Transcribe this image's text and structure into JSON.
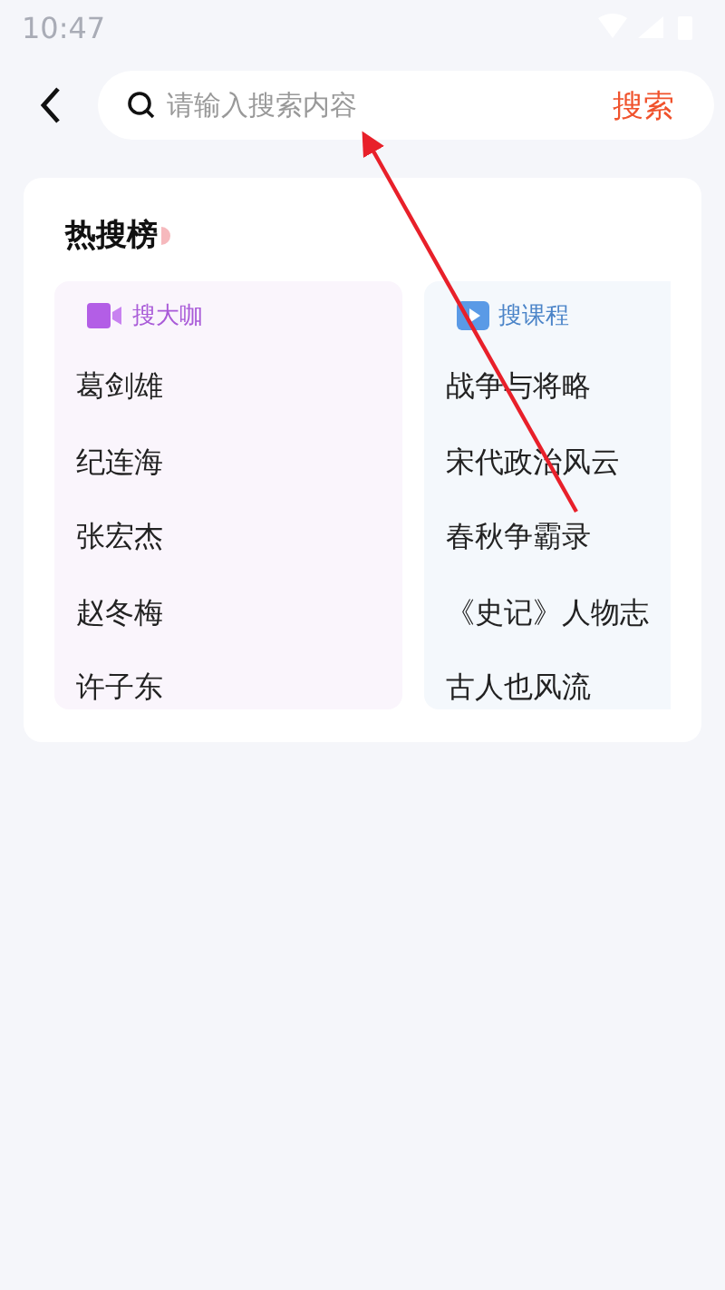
{
  "status_bar": {
    "time": "10:47"
  },
  "search": {
    "placeholder": "请输入搜索内容",
    "button": "搜索"
  },
  "hot": {
    "title": "热搜榜",
    "columns": [
      {
        "kind": "people",
        "title": "搜大咖",
        "items": [
          "葛剑雄",
          "纪连海",
          "张宏杰",
          "赵冬梅",
          "许子东"
        ]
      },
      {
        "kind": "courses",
        "title": "搜课程",
        "items": [
          "战争与将略",
          "宋代政治风云",
          "春秋争霸录",
          "《史记》人物志",
          "古人也风流"
        ]
      }
    ]
  }
}
